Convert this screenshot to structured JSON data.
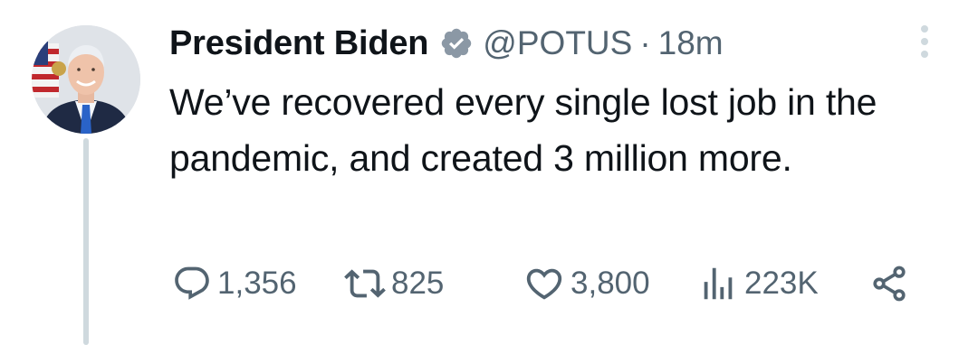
{
  "tweet": {
    "author": {
      "display_name": "President Biden",
      "handle": "@POTUS",
      "verified": true,
      "verified_badge_color": "#8b98a5",
      "avatar_icon": "avatar-photo"
    },
    "separator": "·",
    "time_ago": "18m",
    "text": "We’ve recovered every single lost job in the pandemic, and created 3 million more.",
    "actions": {
      "replies": {
        "icon": "reply-icon",
        "count": "1,356"
      },
      "retweets": {
        "icon": "retweet-icon",
        "count": "825"
      },
      "likes": {
        "icon": "heart-icon",
        "count": "3,800"
      },
      "views": {
        "icon": "views-icon",
        "count": "223K"
      },
      "share": {
        "icon": "share-icon"
      }
    },
    "colors": {
      "text": "#0f1419",
      "muted": "#536471",
      "thread_line": "#cfd9de"
    }
  }
}
